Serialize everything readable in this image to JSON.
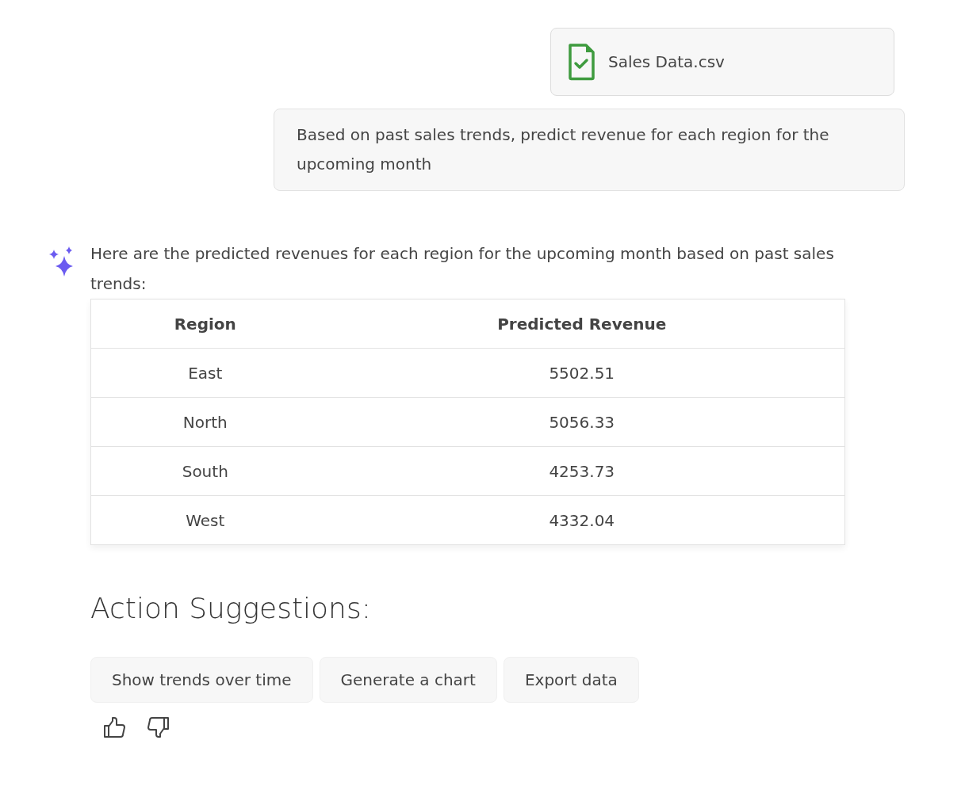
{
  "attachment": {
    "filename": "Sales Data.csv"
  },
  "user_message": "Based on past sales trends, predict revenue for each region for the upcoming month",
  "assistant": {
    "intro": "Here are the predicted revenues for each region for the upcoming month based on past sales trends:",
    "table": {
      "columns": [
        "Region",
        "Predicted Revenue"
      ],
      "rows": [
        [
          "East",
          "5502.51"
        ],
        [
          "North",
          "5056.33"
        ],
        [
          "South",
          "4253.73"
        ],
        [
          "West",
          "4332.04"
        ]
      ]
    },
    "suggestions_heading": "Action Suggestions:",
    "suggestions": [
      "Show trends over time",
      "Generate a chart",
      "Export data"
    ]
  }
}
